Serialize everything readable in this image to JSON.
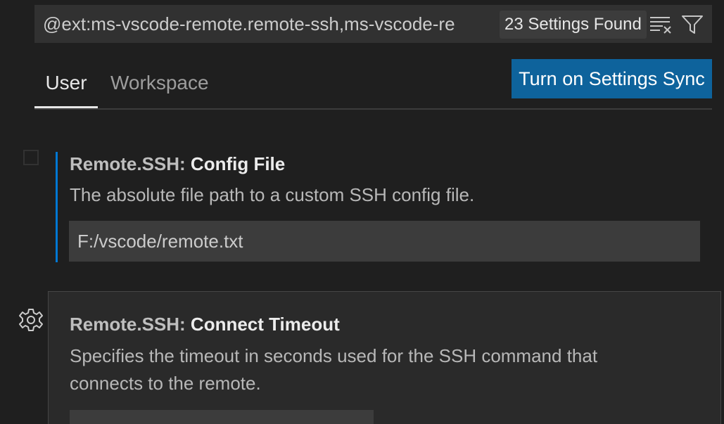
{
  "search": {
    "query": "@ext:ms-vscode-remote.remote-ssh,ms-vscode-re",
    "result_count": "23 Settings Found",
    "clear_icon": "clear-filter-icon",
    "filter_icon": "filter-icon"
  },
  "tabs": [
    {
      "label": "User",
      "active": true
    },
    {
      "label": "Workspace",
      "active": false
    }
  ],
  "sync_button": {
    "label": "Turn on Settings Sync",
    "color": "#0e639c"
  },
  "settings": [
    {
      "category": "Remote.SSH: ",
      "name": "Config File",
      "description": "The absolute file path to a custom SSH config file.",
      "value": "F:/vscode/remote.txt",
      "modified": true
    },
    {
      "category": "Remote.SSH: ",
      "name": "Connect Timeout",
      "description": "Specifies the timeout in seconds used for the SSH command that connects to the remote.",
      "value": "",
      "gear_icon": "gear-icon"
    }
  ],
  "colors": {
    "background": "#1f1f1f",
    "accent": "#0078d4",
    "button": "#0e639c"
  }
}
